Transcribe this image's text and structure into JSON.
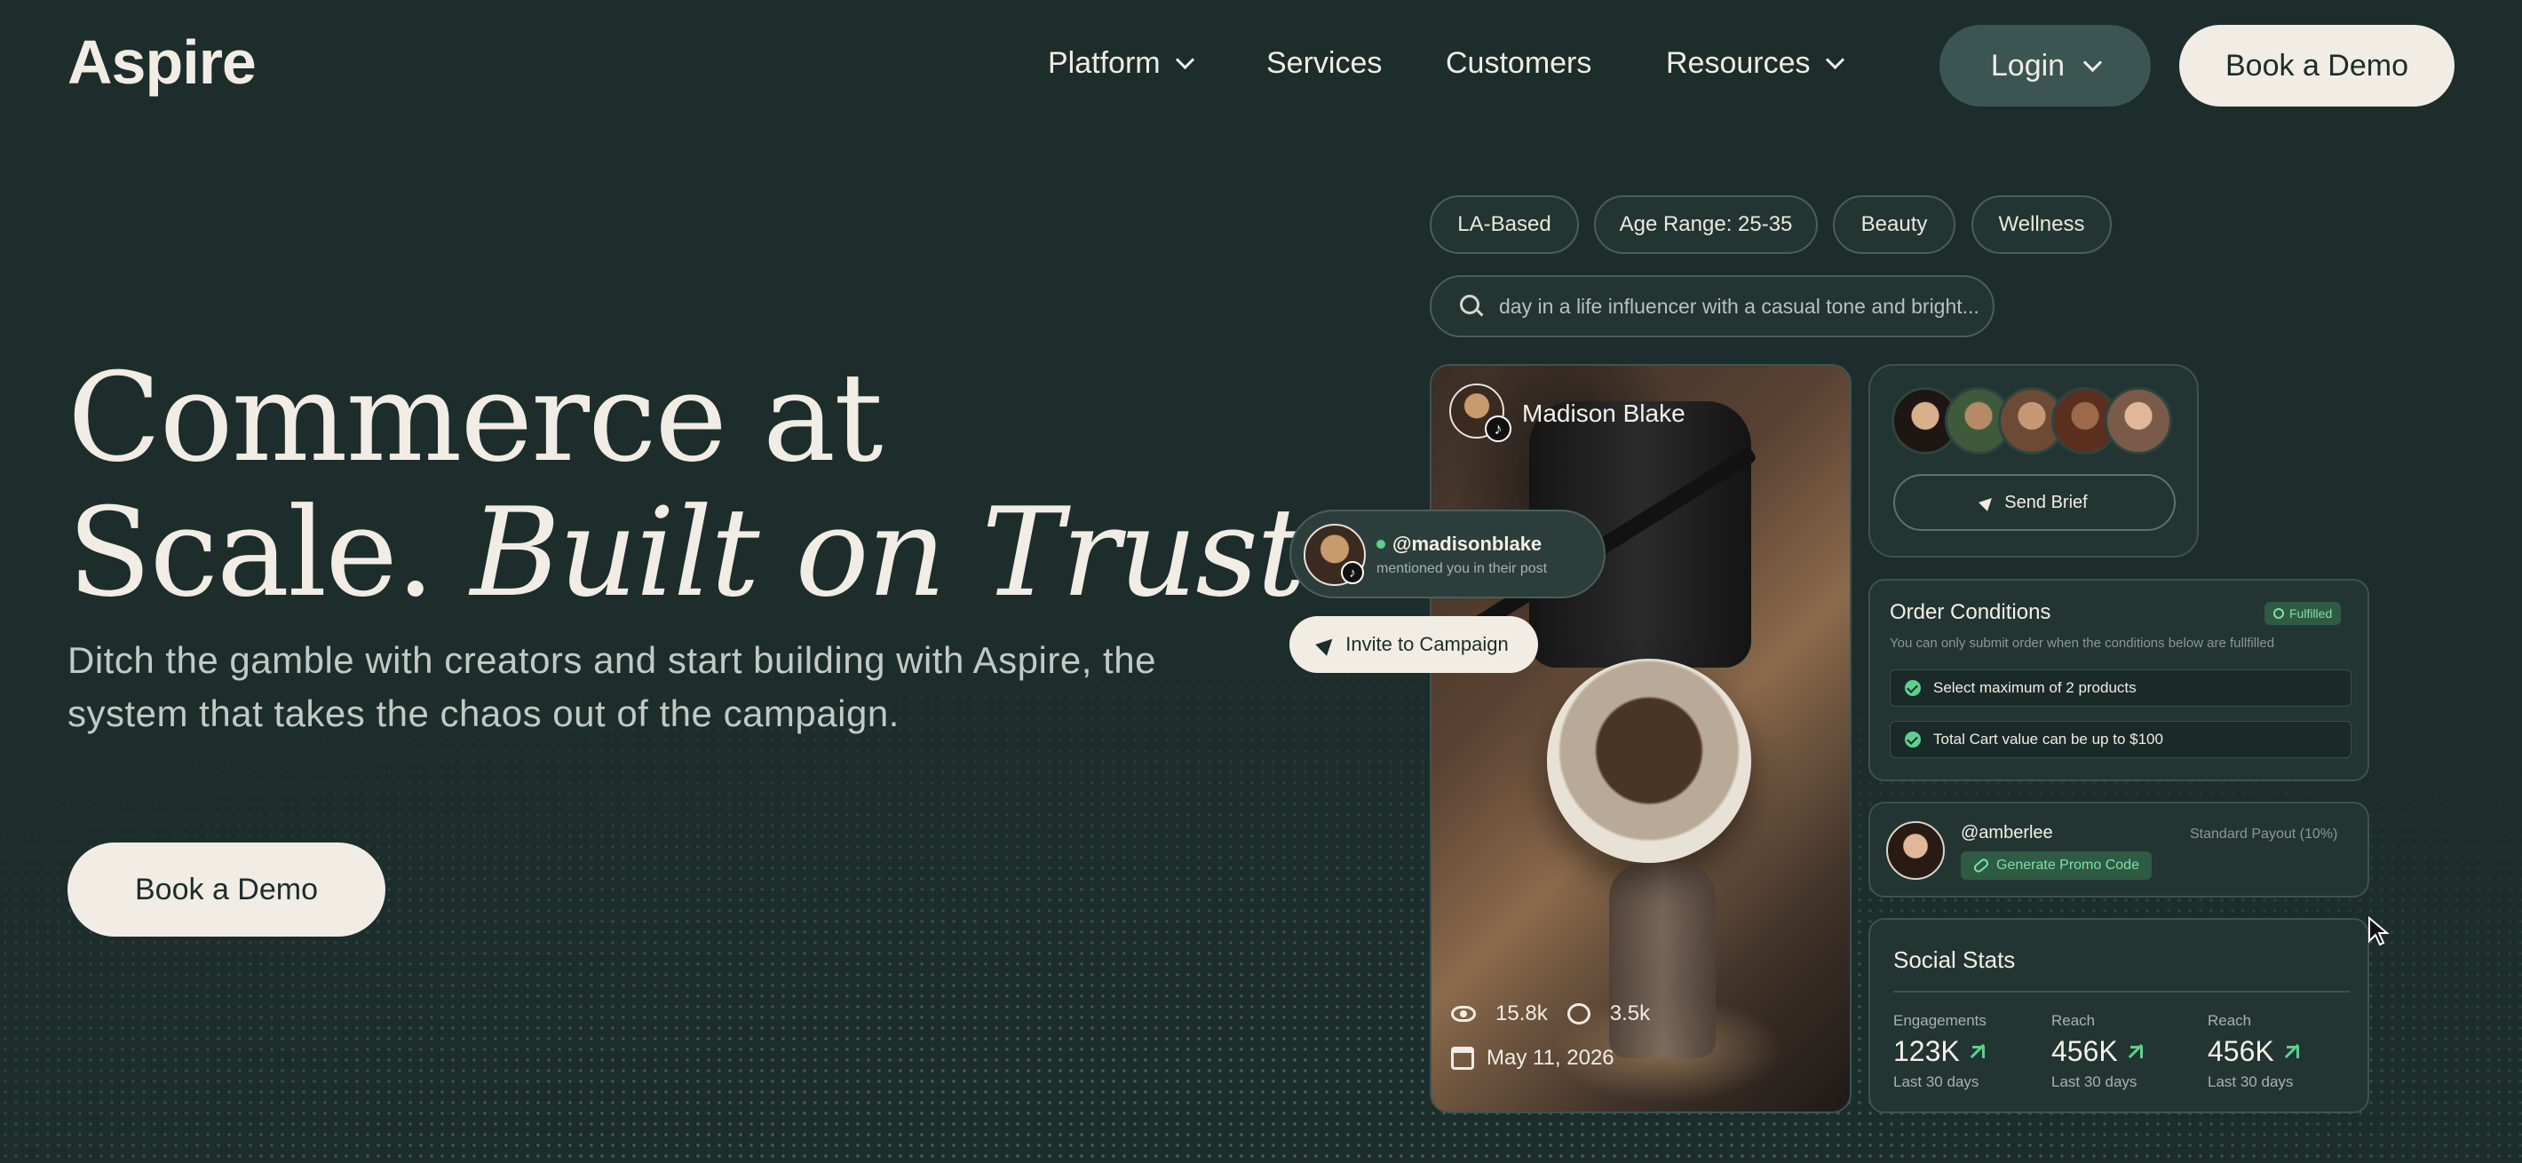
{
  "brand": {
    "logo": "Aspire"
  },
  "nav": {
    "items": [
      {
        "label": "Platform",
        "has_dropdown": true
      },
      {
        "label": "Services",
        "has_dropdown": false
      },
      {
        "label": "Customers",
        "has_dropdown": false
      },
      {
        "label": "Resources",
        "has_dropdown": true
      }
    ],
    "login_label": "Login",
    "demo_label": "Book a Demo"
  },
  "hero": {
    "title_line1": "Commerce at",
    "title_line2_plain": "Scale.",
    "title_line2_italic": "Built on Trust",
    "subtitle": "Ditch the gamble with creators and start building with Aspire, the system that takes the chaos out of the campaign.",
    "cta_label": "Book a Demo"
  },
  "filters": {
    "tags": [
      "LA-Based",
      "Age Range: 25-35",
      "Beauty",
      "Wellness"
    ],
    "search_value": "day in a life influencer with a casual tone and bright..."
  },
  "creator_card": {
    "name": "Madison Blake",
    "platform_icon": "tiktok-icon",
    "views": "15.8k",
    "comments": "3.5k",
    "date": "May 11, 2026"
  },
  "mention": {
    "handle": "@madisonblake",
    "text": "mentioned you in their post",
    "invite_label": "Invite to Campaign"
  },
  "brief_card": {
    "avatar_count": 5,
    "send_label": "Send Brief"
  },
  "order_conditions": {
    "title": "Order Conditions",
    "status": "Fulfilled",
    "description": "You can only submit order when the conditions below are fullfilled",
    "conditions": [
      "Select maximum of 2 products",
      "Total Cart value can be up to $100"
    ]
  },
  "promo": {
    "handle": "@amberlee",
    "payout": "Standard Payout (10%)",
    "button_label": "Generate Promo Code"
  },
  "social_stats": {
    "title": "Social Stats",
    "stats": [
      {
        "label": "Engagements",
        "value": "123K",
        "period": "Last 30 days"
      },
      {
        "label": "Reach",
        "value": "456K",
        "period": "Last 30 days"
      },
      {
        "label": "Reach",
        "value": "456K",
        "period": "Last 30 days"
      }
    ]
  },
  "colors": {
    "background": "#1c2d2b",
    "cream": "#f1ece4",
    "accent_green": "#5cd18d",
    "card": "#223532"
  }
}
